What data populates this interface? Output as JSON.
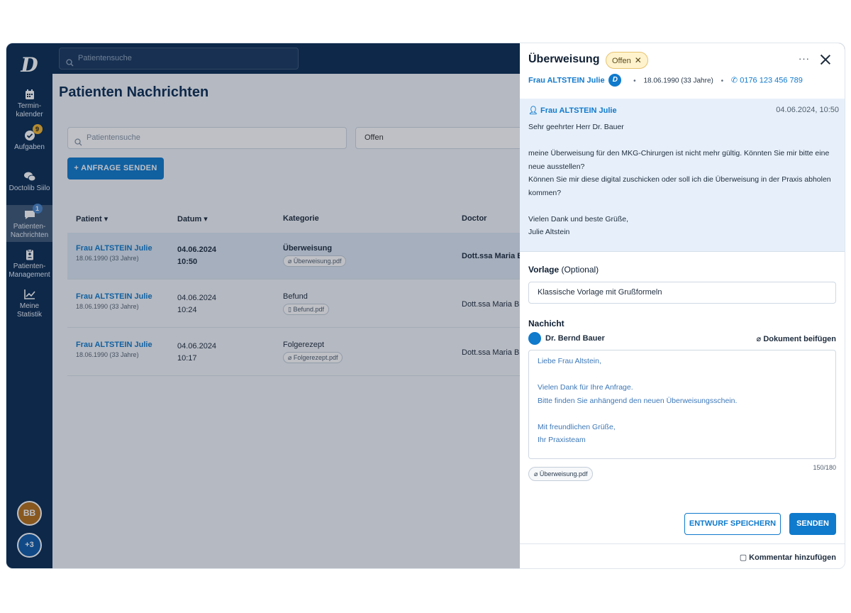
{
  "sidebar": {
    "logo": "D",
    "items": [
      {
        "label": "Termin-\nkalender"
      },
      {
        "label": "Aufgaben",
        "badge": "9"
      },
      {
        "label": "Doctolib Siilo"
      },
      {
        "label": "Patienten-\nNachrichten",
        "badge": "1"
      },
      {
        "label": "Patienten-\nManagement"
      },
      {
        "label": "Meine\nStatistik"
      }
    ],
    "user_initials": "BB",
    "more_count": "+3"
  },
  "topbar": {
    "search_placeholder": "Patientensuche"
  },
  "main": {
    "title": "Patienten Nachrichten",
    "search_placeholder": "Patientensuche",
    "status_filter": "Offen",
    "request_button": "+ ANFRAGE SENDEN",
    "columns": [
      "Patient ▾",
      "Datum ▾",
      "Kategorie",
      "Doctor"
    ],
    "rows": [
      {
        "name": "Frau ALTSTEIN Julie",
        "dob": "18.06.1990 (33 Jahre)",
        "date": "04.06.2024",
        "time": "10:50",
        "category": "Überweisung",
        "file": "Überweisung.pdf",
        "doctor": "Dott.ssa Maria Bi"
      },
      {
        "name": "Frau ALTSTEIN Julie",
        "dob": "18.06.1990 (33 Jahre)",
        "date": "04.06.2024",
        "time": "10:24",
        "category": "Befund",
        "file": "Befund.pdf",
        "doctor": "Dott.ssa Maria Bi"
      },
      {
        "name": "Frau ALTSTEIN Julie",
        "dob": "18.06.1990 (33 Jahre)",
        "date": "04.06.2024",
        "time": "10:17",
        "category": "Folgerezept",
        "file": "Folgerezept.pdf",
        "doctor": "Dott.ssa Maria Bi"
      }
    ]
  },
  "panel": {
    "title": "Überweisung",
    "status": "Offen",
    "patient_name": "Frau ALTSTEIN Julie",
    "patient_dob": "18.06.1990 (33 Jahre)",
    "patient_phone": "0176 123 456 789",
    "message": {
      "from": "Frau ALTSTEIN Julie",
      "datetime": "04.06.2024, 10:50",
      "body": "Sehr geehrter Herr Dr. Bauer\n\nmeine Überweisung für den MKG-Chirurgen ist nicht mehr gültig. Könnten Sie mir bitte eine neue ausstellen?\nKönnen Sie mir diese digital zuschicken oder soll ich die Überweisung in der Praxis abholen kommen?\n\nVielen Dank und beste Grüße,\nJulie Altstein"
    },
    "vorlage_label": "Vorlage",
    "vorlage_optional": "(Optional)",
    "vorlage_value": "Klassische Vorlage mit Grußformeln",
    "nachricht_label": "Nachicht",
    "sender": "Dr. Bernd Bauer",
    "attach_label": "Dokument beifügen",
    "reply": "Liebe Frau Altstein,\n\nVielen Dank für Ihre Anfrage.\nBitte finden Sie anhängend den neuen Überweisungsschein.\n\nMit freundlichen Grüße,\nIhr Praxisteam",
    "char_count": "150/180",
    "attachment": "Überweisung.pdf",
    "draft_button": "ENTWURF SPEICHERN",
    "send_button": "SENDEN",
    "comment_button": "Kommentar hinzufügen"
  },
  "colors": {
    "navy": "#0b2d54",
    "accent": "#107acc",
    "status_bg": "#fff3cd"
  }
}
